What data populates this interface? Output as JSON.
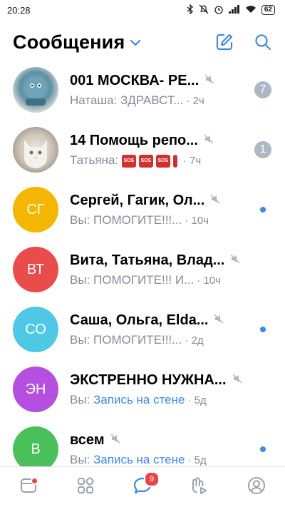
{
  "status": {
    "time": "20:28",
    "battery": "62"
  },
  "header": {
    "title": "Сообщения"
  },
  "chats": [
    {
      "name": "001 МОСКВА- РЕ...",
      "prefix": "Наташа: ",
      "message": "ЗДРАВСТ...",
      "time": "· 2ч",
      "unread": "7",
      "muted": true,
      "avatar_initials": "",
      "avatar_color": "#8aa7b5"
    },
    {
      "name": "14 Помощь репо...",
      "prefix": "Татьяна: ",
      "message": "",
      "time": "· 7ч",
      "unread": "1",
      "muted": true,
      "avatar_initials": "",
      "avatar_color": "#b8b0a6"
    },
    {
      "name": "Сергей, Гагик, Ол...",
      "prefix": "Вы: ",
      "message": "ПОМОГИТЕ!!!...",
      "time": "· 10ч",
      "muted": true,
      "avatar_initials": "СГ",
      "avatar_color": "#f5b600"
    },
    {
      "name": "Вита, Татьяна, Влад...",
      "prefix": "Вы: ",
      "message": "ПОМОГИТЕ!!! И...",
      "time": "· 10ч",
      "muted": true,
      "avatar_initials": "ВТ",
      "avatar_color": "#ea4b4b"
    },
    {
      "name": "Саша, Ольга, Elda...",
      "prefix": "Вы: ",
      "message": "ПОМОГИТЕ!!!...",
      "time": "· 2д",
      "muted": true,
      "avatar_initials": "СО",
      "avatar_color": "#4fc8e6"
    },
    {
      "name": "ЭКСТРЕННО НУЖНА...",
      "prefix": "Вы: ",
      "message": "Запись на стене",
      "time": "· 5д",
      "muted": true,
      "avatar_initials": "ЭН",
      "avatar_color": "#b44fe0"
    },
    {
      "name": "всем",
      "prefix": "Вы: ",
      "message": "Запись на стене",
      "time": "· 5д",
      "muted": true,
      "avatar_initials": "В",
      "avatar_color": "#4bbf5a"
    }
  ],
  "sos_label": "SOS",
  "tabbar": {
    "messages_badge": "9"
  },
  "colors": {
    "accent": "#3f8ae0",
    "muted_text": "#818c99",
    "badge_grey": "#aeb7c2",
    "badge_red": "#e64646"
  }
}
